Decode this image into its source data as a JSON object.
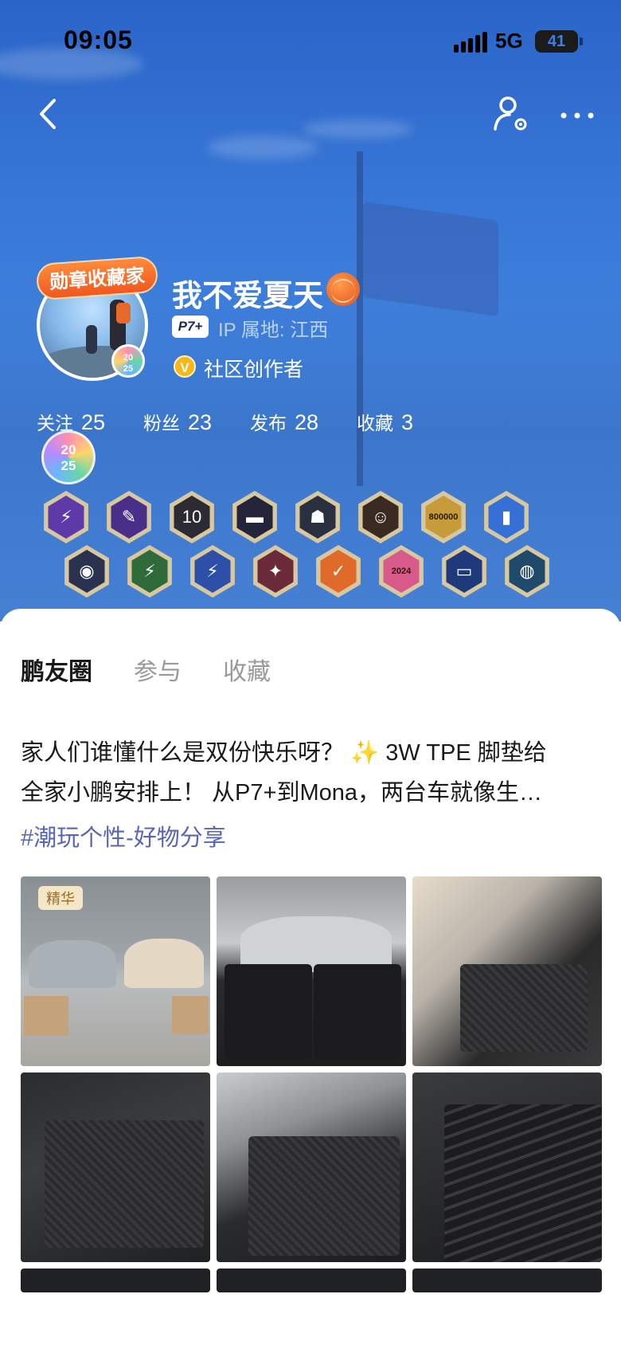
{
  "status_bar": {
    "time": "09:05",
    "network": "5G",
    "battery": "41"
  },
  "nav": {
    "back_icon": "chevron-left-icon",
    "user_settings_icon": "user-settings-icon",
    "more_icon": "more-icon"
  },
  "profile": {
    "badge_ribbon": "勋章收藏家",
    "avatar_year": "20\n25",
    "name": "我不爱夏天",
    "car_tag": "P7+",
    "ip_location": "IP 属地: 江西",
    "creator_badge_letter": "V",
    "creator_label": "社区创作者",
    "year_badge": "20\n25"
  },
  "stats": [
    {
      "label": "关注",
      "value": "25"
    },
    {
      "label": "粉丝",
      "value": "23"
    },
    {
      "label": "发布",
      "value": "28"
    },
    {
      "label": "收藏",
      "value": "3"
    }
  ],
  "medals_row1": [
    {
      "name": "lightning-medal",
      "glyph": "⚡",
      "color": "#5d3aa8"
    },
    {
      "name": "pencil-medal",
      "glyph": "✎",
      "color": "#4a2f8a"
    },
    {
      "name": "ten-medal",
      "glyph": "10",
      "color": "#2c2a33"
    },
    {
      "name": "chat-medal",
      "glyph": "▬",
      "color": "#23243a"
    },
    {
      "name": "robot-medal",
      "glyph": "☗",
      "color": "#2a3040"
    },
    {
      "name": "smile-medal",
      "glyph": "☺",
      "color": "#3a2a22"
    },
    {
      "name": "800000-medal",
      "glyph": "800000",
      "color": "#c79a3a"
    },
    {
      "name": "phone-medal",
      "glyph": "▮",
      "color": "#3570d6"
    }
  ],
  "medals_row2": [
    {
      "name": "wheel-medal",
      "glyph": "◉",
      "color": "#2b3250"
    },
    {
      "name": "green-lightning-medal",
      "glyph": "⚡",
      "color": "#2f6a3a"
    },
    {
      "name": "blue-lightning-medal",
      "glyph": "⚡",
      "color": "#2e4fa8"
    },
    {
      "name": "fire-medal",
      "glyph": "✦",
      "color": "#6a2a3a"
    },
    {
      "name": "calendar-medal",
      "glyph": "✓",
      "color": "#e06a2a"
    },
    {
      "name": "year-2024-medal",
      "glyph": "2024",
      "color": "#d85a8a"
    },
    {
      "name": "car-city-medal",
      "glyph": "▭",
      "color": "#1f3a7a"
    },
    {
      "name": "earth-medal",
      "glyph": "◍",
      "color": "#1f4a6a"
    }
  ],
  "tabs": [
    "鹏友圈",
    "参与",
    "收藏"
  ],
  "post": {
    "line1": "家人们谁懂什么是双份快乐呀？ ✨ 3W TPE 脚垫给",
    "line2": "全家小鹏安排上！ 从P7+到Mona，两台车就像生…",
    "hashtag": "#潮玩个性-好物分享",
    "essence_tag": "精华"
  }
}
